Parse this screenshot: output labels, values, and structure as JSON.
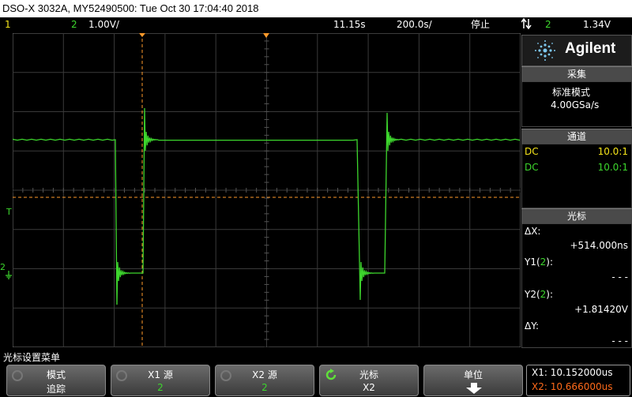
{
  "window": {
    "title": "DSO-X 3032A, MY52490500: Tue Oct 30 17:04:40 2018"
  },
  "status": {
    "ch1_label": "1",
    "ch2_label": "2",
    "ch2_scale": "1.00V/",
    "time_offset": "11.15s",
    "time_scale": "200.0s/",
    "run_state": "停止",
    "trigger_icon": "trigger-edge-icon",
    "trigger_channel": "2",
    "trigger_level": "1.34V"
  },
  "colors": {
    "ch1": "#f5e41a",
    "ch2": "#3dd62d",
    "cursor": "#ff9a2a",
    "x2": "#ff6a1a"
  },
  "panel": {
    "brand": "Agilent",
    "acq_header": "采集",
    "acq_mode": "标准模式",
    "acq_rate": "4.00GSa/s",
    "channel_header": "通道",
    "channels": [
      {
        "coupling": "DC",
        "probe": "10.0:1"
      },
      {
        "coupling": "DC",
        "probe": "10.0:1"
      }
    ],
    "cursor_header": "光标",
    "dx_label": "ΔX:",
    "dx_value": "+514.000ns",
    "y1_label_pre": "Y1(",
    "y1_label_ch": "2",
    "y1_label_post": "):",
    "y1_value": "- - -",
    "y2_label_pre": "Y2(",
    "y2_label_ch": "2",
    "y2_label_post": "):",
    "y2_value": "+1.81420V",
    "dy_label": "ΔY:",
    "dy_value": "- - -"
  },
  "menu": {
    "title": "光标设置菜单",
    "softkeys": [
      {
        "line1": "模式",
        "line2": "追踪"
      },
      {
        "line1": "X1 源",
        "line2": "2"
      },
      {
        "line1": "X2 源",
        "line2": "2"
      },
      {
        "line1": "光标",
        "line2": "X2"
      },
      {
        "line1": "单位",
        "line2": ""
      }
    ],
    "x1_readout": "X1: 10.152000us",
    "x2_readout": "X2: 10.666000us"
  },
  "markers": {
    "trigger_label": "T",
    "ground_label": "2"
  }
}
